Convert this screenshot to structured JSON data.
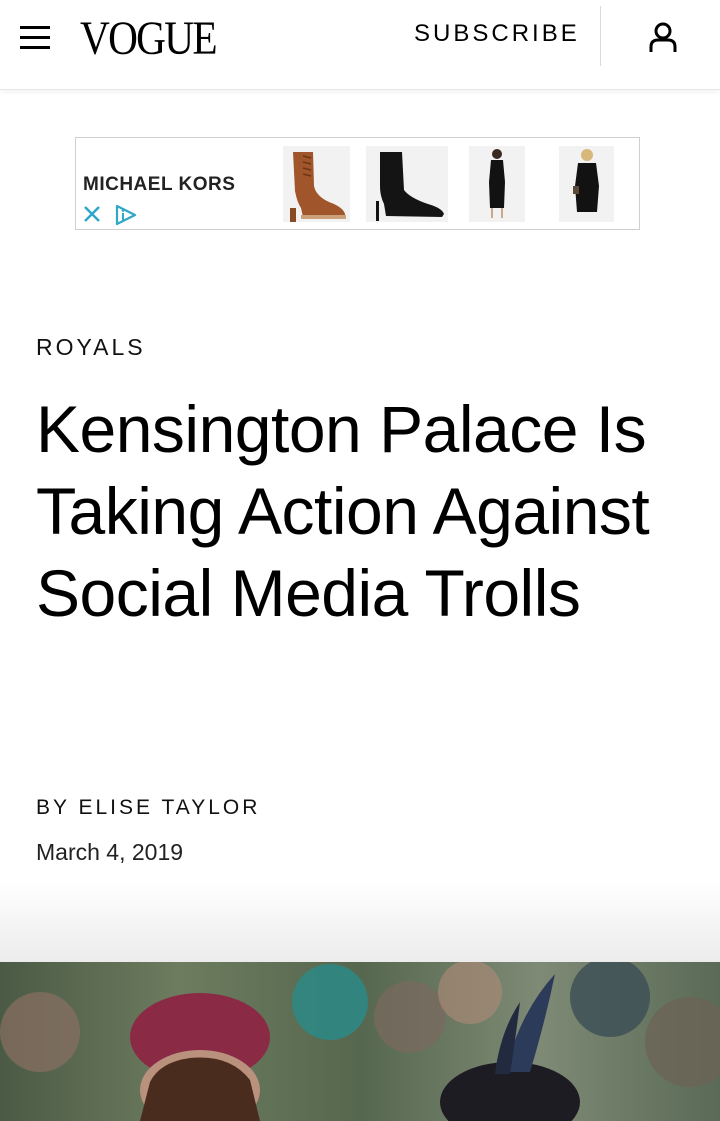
{
  "header": {
    "menu_icon": "hamburger-menu-icon",
    "logo": "VOGUE",
    "subscribe_label": "SUBSCRIBE",
    "account_icon": "user-account-icon"
  },
  "ad": {
    "brand": "MICHAEL KORS",
    "close_icon": "close-x-icon",
    "adchoices_icon": "adchoices-icon",
    "products": [
      {
        "icon": "brown-lace-up-boot"
      },
      {
        "icon": "black-stiletto-bootie"
      },
      {
        "icon": "black-midi-dress-model"
      },
      {
        "icon": "black-sweater-dress-model"
      }
    ],
    "accent_color": "#2fa8c8"
  },
  "article": {
    "kicker": "ROYALS",
    "headline": "Kensington Palace Is Taking Action Against Social Media Trolls",
    "byline_prefix": "BY",
    "author": "ELISE TAYLOR",
    "date": "March 4, 2019"
  },
  "hero": {
    "description_icon": "royals-crowd-photo"
  }
}
